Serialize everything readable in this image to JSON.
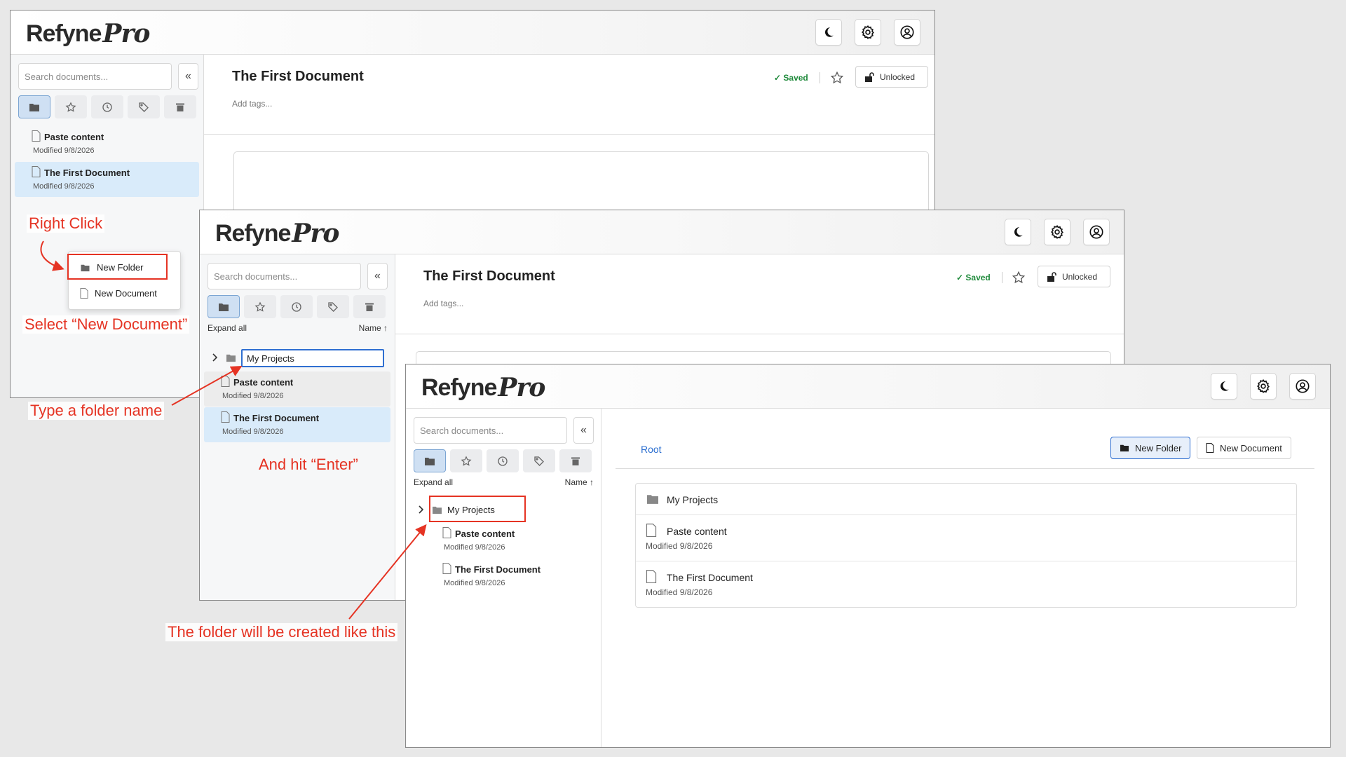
{
  "app": {
    "logo_main": "Refyne",
    "logo_script": "Pro"
  },
  "header_icons": [
    "moon-icon",
    "gear-icon",
    "user-icon"
  ],
  "sidebar": {
    "search_placeholder": "Search documents...",
    "collapse_label": "«",
    "view_tabs": [
      "folder-icon",
      "star-icon",
      "clock-icon",
      "tag-icon",
      "trash-icon"
    ],
    "expand_all": "Expand all",
    "sort_label": "Name ↑"
  },
  "document": {
    "title": "The First Document",
    "tags_placeholder": "Add tags...",
    "saved_status": "✓ Saved",
    "lock_status": "Unlocked"
  },
  "files": [
    {
      "name": "Paste content",
      "modified": "Modified 9/8/2026"
    },
    {
      "name": "The First Document",
      "modified": "Modified 9/8/2026"
    }
  ],
  "context_menu": {
    "new_folder": "New Folder",
    "new_document": "New Document"
  },
  "folder": {
    "name": "My Projects"
  },
  "explorer": {
    "breadcrumb": "Root",
    "new_folder_btn": "New Folder",
    "new_document_btn": "New Document"
  },
  "annotations": {
    "right_click": "Right Click",
    "select": "Select “New Document”",
    "type_name": "Type a folder name",
    "hit_enter": "And hit “Enter”",
    "created": "The folder will be created like this"
  },
  "colors": {
    "annotation": "#e53323",
    "accent": "#2f6fd1",
    "saved": "#1f8a3b",
    "selected_row": "#d9ebfa"
  }
}
